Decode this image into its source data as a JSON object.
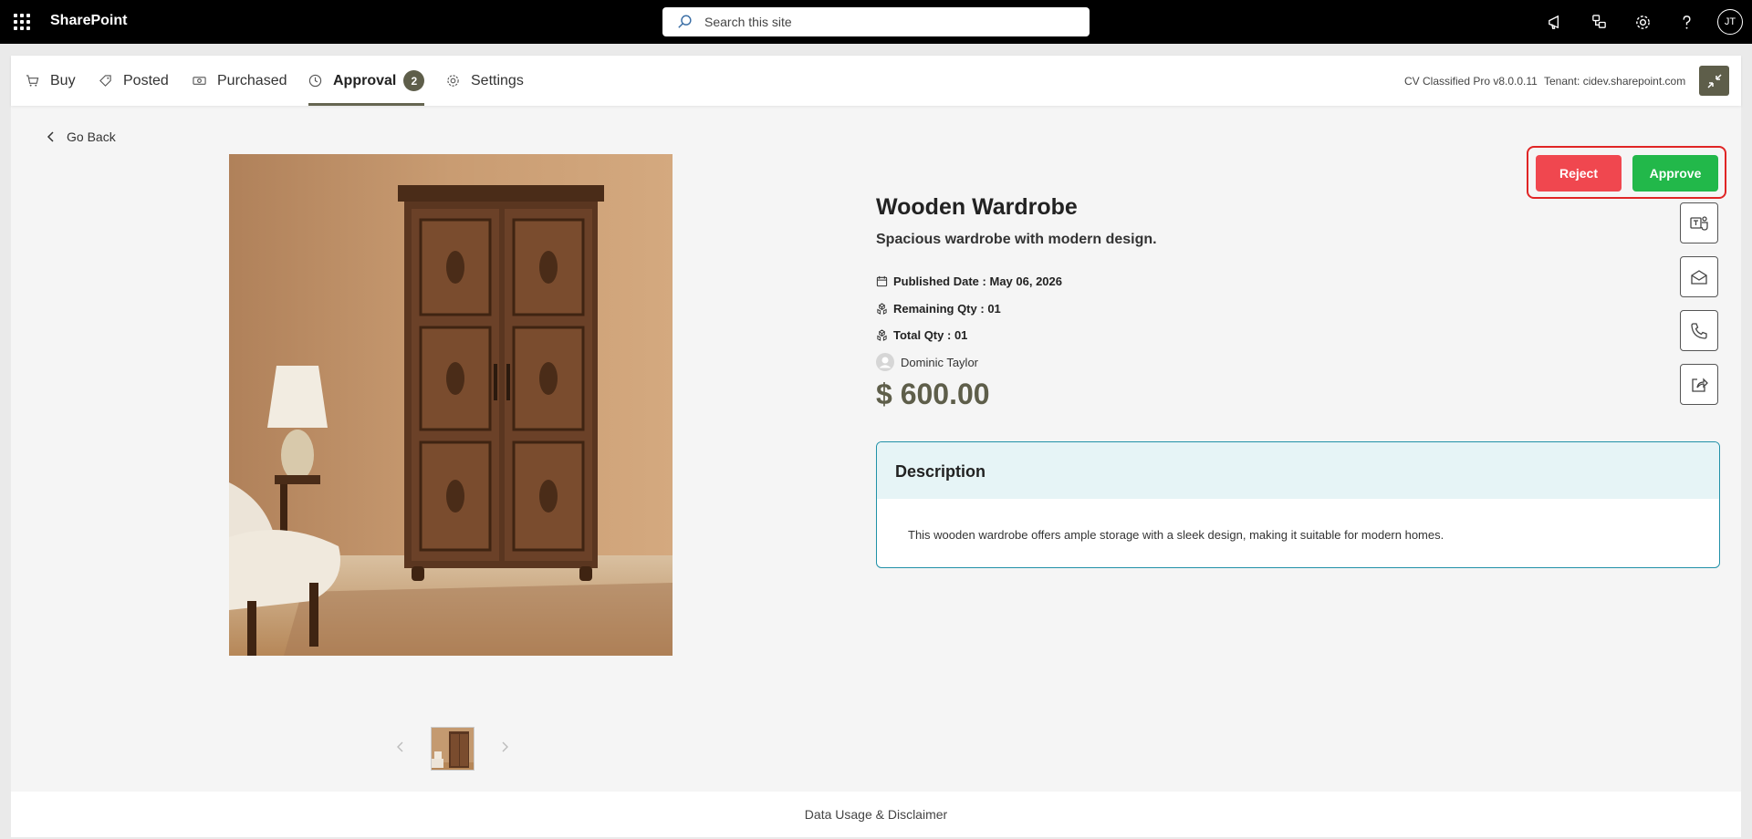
{
  "suitebar": {
    "brand": "SharePoint",
    "search_placeholder": "Search this site",
    "user_initials": "JT"
  },
  "nav": {
    "tabs": [
      {
        "label": "Buy",
        "icon": "cart-icon"
      },
      {
        "label": "Posted",
        "icon": "tag-icon"
      },
      {
        "label": "Purchased",
        "icon": "money-icon"
      },
      {
        "label": "Approval",
        "icon": "clock-icon",
        "badge": "2",
        "active": true
      },
      {
        "label": "Settings",
        "icon": "gear-icon"
      }
    ],
    "version": "CV Classified Pro v8.0.0.11",
    "tenant": "Tenant: cidev.sharepoint.com"
  },
  "page": {
    "go_back": "Go Back",
    "reject": "Reject",
    "approve": "Approve"
  },
  "product": {
    "title": "Wooden Wardrobe",
    "subtitle": "Spacious wardrobe with modern design.",
    "published_label": "Published Date :",
    "published_value": "May 06, 2026",
    "remaining_label": "Remaining Qty :",
    "remaining_value": "01",
    "total_label": "Total Qty :",
    "total_value": "01",
    "seller": "Dominic Taylor",
    "price": "$ 600.00",
    "description_heading": "Description",
    "description": "This wooden wardrobe offers ample storage with a sleek design, making it suitable for modern homes."
  },
  "footer": {
    "link": "Data Usage & Disclaimer"
  },
  "colors": {
    "accent": "#5e5e4a",
    "reject": "#f0474f",
    "approve": "#22b84a",
    "desc_border": "#2191a8"
  }
}
